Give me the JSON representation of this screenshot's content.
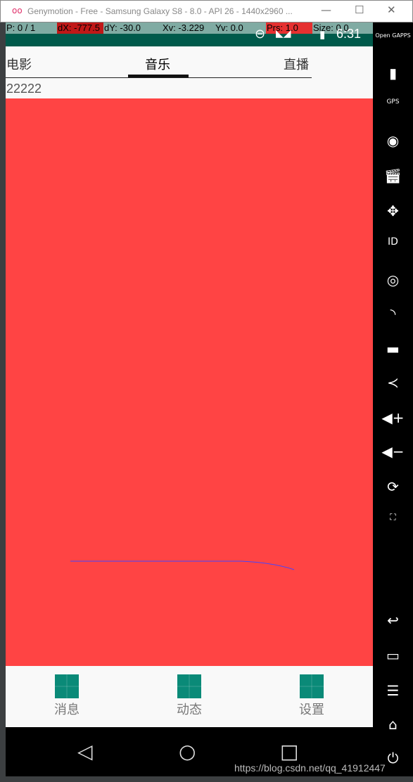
{
  "window": {
    "title": "Genymotion - Free - Samsung Galaxy S8 - 8.0 - API 26 - 1440x2960 ...",
    "logo": "oo"
  },
  "debug": {
    "p": "P: 0 / 1",
    "dx": "dX: -777.5",
    "dy": "dY: -30.0",
    "xv": "Xv: -3.229",
    "yv": "Yv: 0.0",
    "prs": "Prs: 1.0",
    "size": "Size: 0.0"
  },
  "status": {
    "time": "6:31"
  },
  "tabs": [
    {
      "label": "电影"
    },
    {
      "label": "音乐",
      "selected": true
    },
    {
      "label": "直播"
    }
  ],
  "content": {
    "text": "22222",
    "background": "#ff4444"
  },
  "bottom_nav": [
    {
      "label": "消息"
    },
    {
      "label": "动态"
    },
    {
      "label": "设置"
    }
  ],
  "sidebar": {
    "gapps": "Open GAPPS",
    "items": [
      "battery-icon",
      "gps-icon",
      "webcam-icon",
      "clapper-icon",
      "move-icon",
      "id-icon",
      "disk-icon",
      "cast-icon",
      "sms-icon",
      "share-icon",
      "volume-up-icon",
      "volume-down-icon",
      "rotate-icon",
      "scale-icon",
      "back-icon",
      "recent-icon",
      "menu-icon",
      "home-icon",
      "power-icon"
    ]
  },
  "watermark": "https://blog.csdn.net/qq_41912447"
}
